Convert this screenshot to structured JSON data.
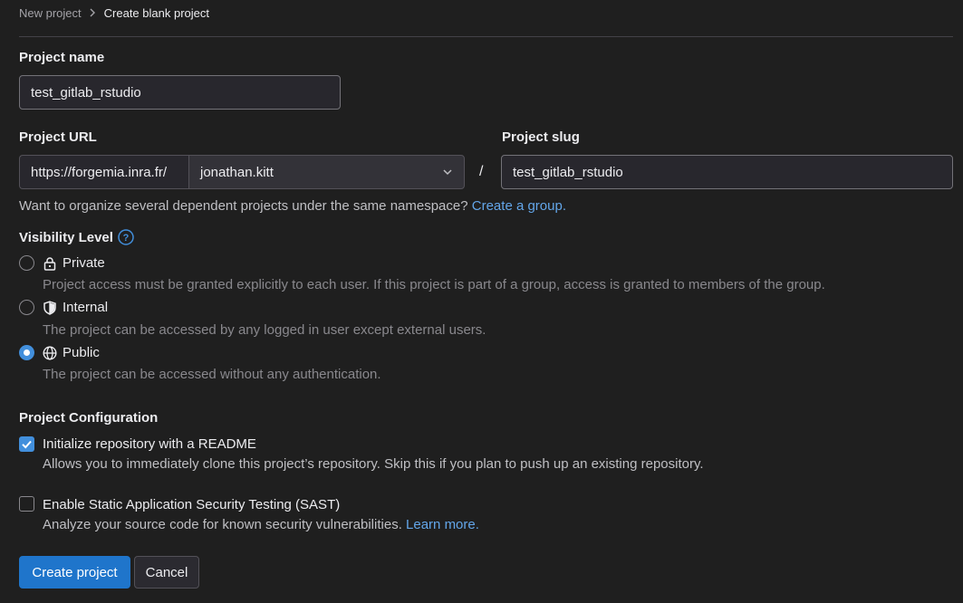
{
  "breadcrumb": {
    "parent": "New project",
    "current": "Create blank project"
  },
  "project_name": {
    "label": "Project name",
    "value": "test_gitlab_rstudio"
  },
  "project_url": {
    "label": "Project URL",
    "prefix": "https://forgemia.inra.fr/",
    "namespace": "jonathan.kitt",
    "separator": "/"
  },
  "project_slug": {
    "label": "Project slug",
    "value": "test_gitlab_rstudio"
  },
  "group_hint": {
    "text": "Want to organize several dependent projects under the same namespace?",
    "link": "Create a group."
  },
  "visibility": {
    "label": "Visibility Level",
    "selected": "public",
    "options": [
      {
        "label": "Private",
        "icon": "lock-icon",
        "help": "Project access must be granted explicitly to each user. If this project is part of a group, access is granted to members of the group."
      },
      {
        "label": "Internal",
        "icon": "shield-icon",
        "help": "The project can be accessed by any logged in user except external users."
      },
      {
        "label": "Public",
        "icon": "globe-icon",
        "help": "The project can be accessed without any authentication."
      }
    ]
  },
  "config": {
    "label": "Project Configuration",
    "readme": {
      "label": "Initialize repository with a README",
      "checked": true,
      "help": "Allows you to immediately clone this project’s repository. Skip this if you plan to push up an existing repository."
    },
    "sast": {
      "label": "Enable Static Application Security Testing (SAST)",
      "checked": false,
      "help": "Analyze your source code for known security vulnerabilities.",
      "link": "Learn more."
    }
  },
  "actions": {
    "create": "Create project",
    "cancel": "Cancel"
  },
  "colors": {
    "background": "#1f1f1f",
    "primary": "#1f75cb",
    "link": "#63a6e9",
    "accent": "#428fdc"
  }
}
